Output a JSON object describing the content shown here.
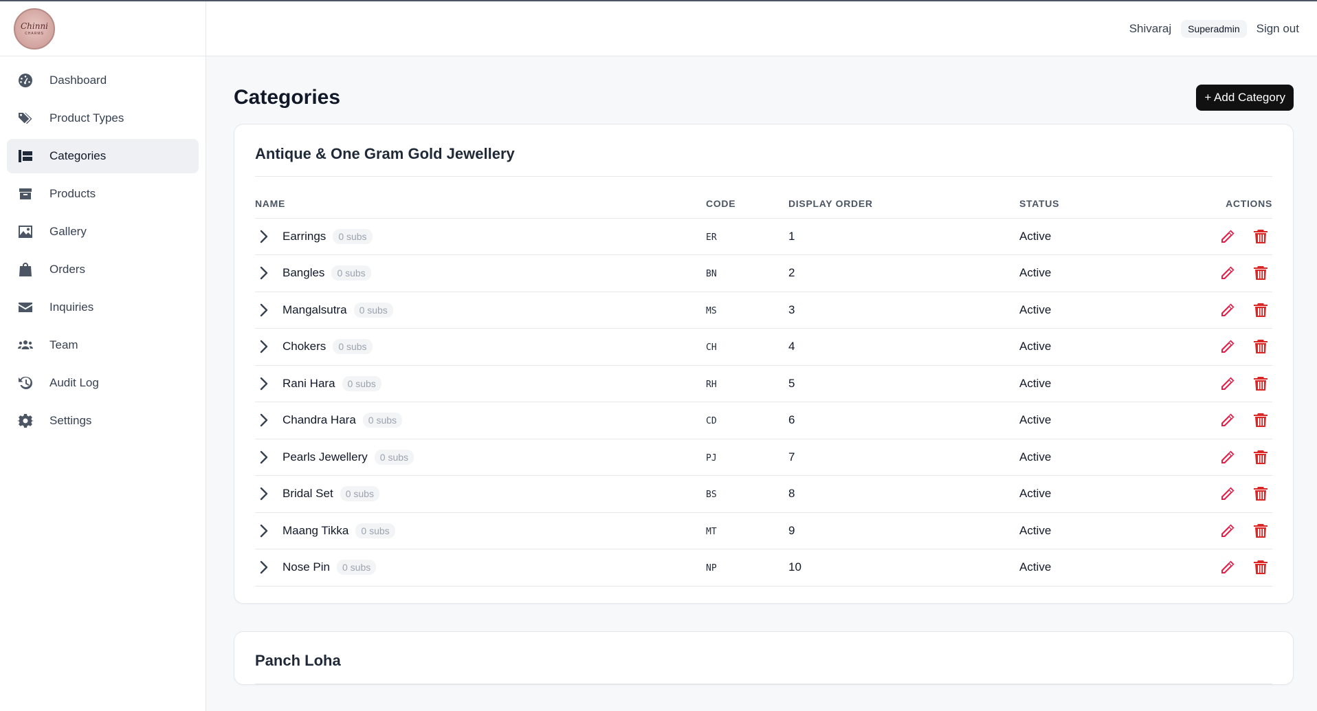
{
  "brand": {
    "logo_text": "Chinni",
    "logo_sub": "CHARMS"
  },
  "sidebar": {
    "items": [
      {
        "label": "Dashboard",
        "icon": "dashboard-icon"
      },
      {
        "label": "Product Types",
        "icon": "tags-icon"
      },
      {
        "label": "Categories",
        "icon": "categories-icon",
        "active": true
      },
      {
        "label": "Products",
        "icon": "box-icon"
      },
      {
        "label": "Gallery",
        "icon": "image-icon"
      },
      {
        "label": "Orders",
        "icon": "shopping-bag-icon"
      },
      {
        "label": "Inquiries",
        "icon": "envelope-icon"
      },
      {
        "label": "Team",
        "icon": "users-icon"
      },
      {
        "label": "Audit Log",
        "icon": "history-icon"
      },
      {
        "label": "Settings",
        "icon": "gear-icon"
      }
    ]
  },
  "topbar": {
    "user": "Shivaraj",
    "role": "Superadmin",
    "signout": "Sign out"
  },
  "page": {
    "title": "Categories",
    "add_button": "+ Add Category"
  },
  "table_headers": {
    "name": "NAME",
    "code": "CODE",
    "order": "DISPLAY ORDER",
    "status": "STATUS",
    "actions": "ACTIONS"
  },
  "groups": [
    {
      "title": "Antique & One Gram Gold Jewellery",
      "rows": [
        {
          "name": "Earrings",
          "subs": "0 subs",
          "code": "ER",
          "order": "1",
          "status": "Active"
        },
        {
          "name": "Bangles",
          "subs": "0 subs",
          "code": "BN",
          "order": "2",
          "status": "Active"
        },
        {
          "name": "Mangalsutra",
          "subs": "0 subs",
          "code": "MS",
          "order": "3",
          "status": "Active"
        },
        {
          "name": "Chokers",
          "subs": "0 subs",
          "code": "CH",
          "order": "4",
          "status": "Active"
        },
        {
          "name": "Rani Hara",
          "subs": "0 subs",
          "code": "RH",
          "order": "5",
          "status": "Active"
        },
        {
          "name": "Chandra Hara",
          "subs": "0 subs",
          "code": "CD",
          "order": "6",
          "status": "Active"
        },
        {
          "name": "Pearls Jewellery",
          "subs": "0 subs",
          "code": "PJ",
          "order": "7",
          "status": "Active"
        },
        {
          "name": "Bridal Set",
          "subs": "0 subs",
          "code": "BS",
          "order": "8",
          "status": "Active"
        },
        {
          "name": "Maang Tikka",
          "subs": "0 subs",
          "code": "MT",
          "order": "9",
          "status": "Active"
        },
        {
          "name": "Nose Pin",
          "subs": "0 subs",
          "code": "NP",
          "order": "10",
          "status": "Active"
        }
      ]
    },
    {
      "title": "Panch Loha",
      "rows": []
    }
  ],
  "colors": {
    "edit": "#e11d48",
    "delete": "#dc2626",
    "primary_button": "#111111"
  }
}
